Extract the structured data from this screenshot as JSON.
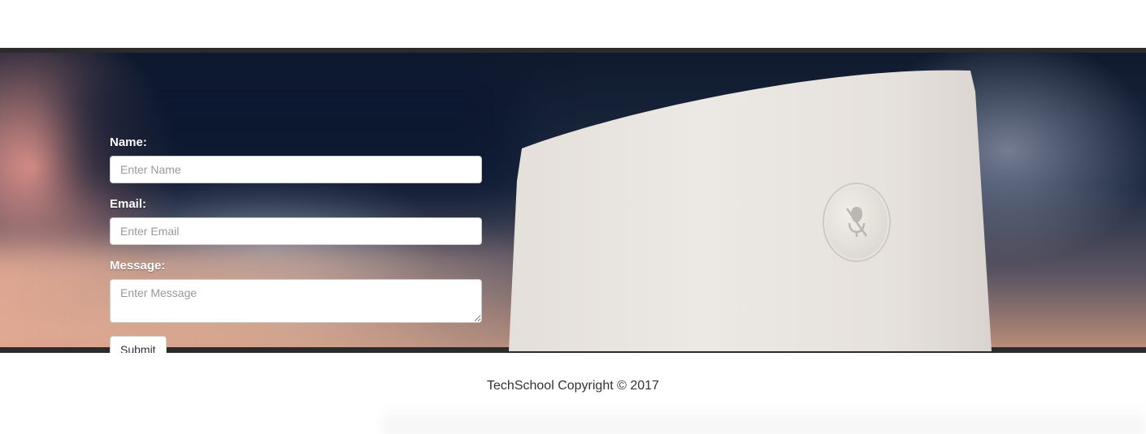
{
  "contact_form": {
    "name_label": "Name:",
    "name_placeholder": "Enter Name",
    "name_value": "",
    "email_label": "Email:",
    "email_placeholder": "Enter Email",
    "email_value": "",
    "message_label": "Message:",
    "message_placeholder": "Enter Message",
    "message_value": "",
    "submit_label": "Submit"
  },
  "hero": {
    "image_subject": "smart-speaker-device",
    "mute_icon": "mic-off-icon"
  },
  "footer": {
    "copyright": "TechSchool Copyright © 2017"
  },
  "colors": {
    "hero_border": "#2b2b2b",
    "label_text": "#ffffff",
    "footer_text": "#333333",
    "input_border": "#cccccc"
  }
}
